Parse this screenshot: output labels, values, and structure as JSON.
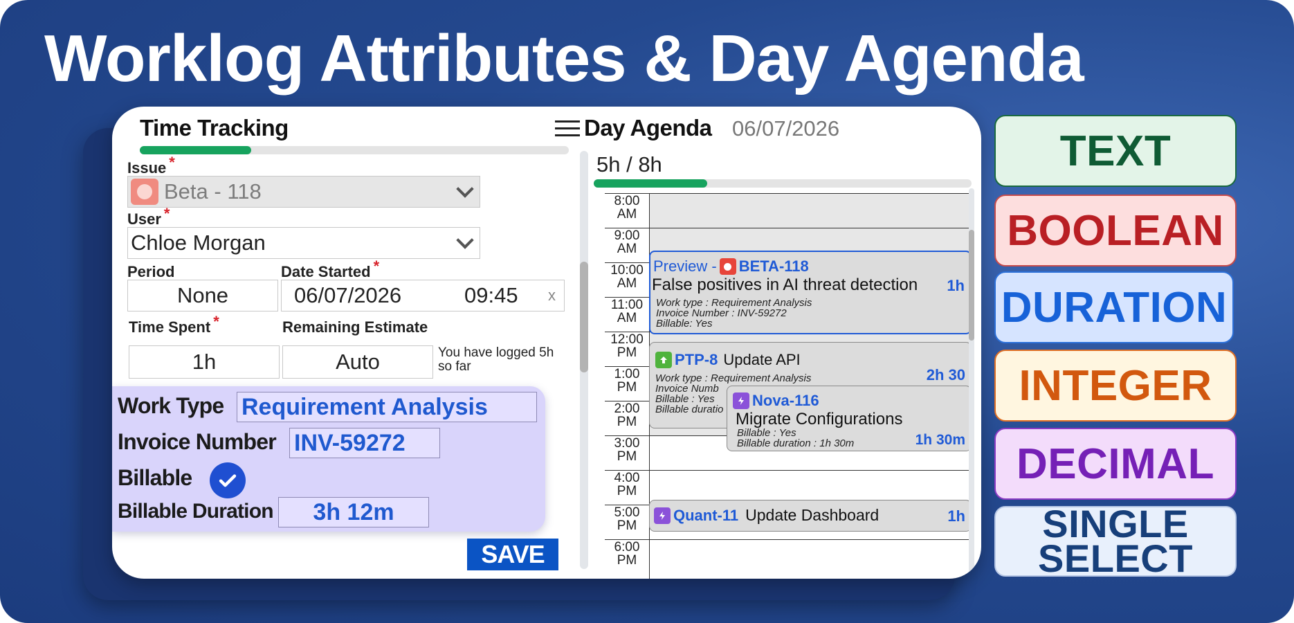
{
  "headline": "Worklog Attributes & Day Agenda",
  "form": {
    "title": "Time Tracking",
    "progress_fraction": 0.26,
    "issue_label": "Issue",
    "issue_value": "Beta - 118",
    "user_label": "User",
    "user_value": "Chloe Morgan",
    "period_label": "Period",
    "period_value": "None",
    "date_label": "Date Started",
    "date_value": "06/07/2026",
    "time_value": "09:45",
    "clear_symbol": "x",
    "time_spent_label": "Time Spent",
    "time_spent_value": "1h",
    "remaining_label": "Remaining Estimate",
    "remaining_value": "Auto",
    "logged_note": "You have logged 5h so far",
    "required_mark": "*",
    "attributes": {
      "work_type_label": "Work Type",
      "work_type_value": "Requirement Analysis",
      "invoice_label": "Invoice Number",
      "invoice_value": "INV-59272",
      "billable_label": "Billable",
      "billable_checked": true,
      "billable_duration_label": "Billable Duration",
      "billable_duration_value": "3h 12m"
    },
    "save_label": "SAVE"
  },
  "agenda": {
    "title": "Day Agenda",
    "date": "06/07/2026",
    "hours_summary": "5h / 8h",
    "progress_fraction": 0.3,
    "slots": [
      {
        "time": "8:00",
        "ampm": "AM"
      },
      {
        "time": "9:00",
        "ampm": "AM"
      },
      {
        "time": "10:00",
        "ampm": "AM"
      },
      {
        "time": "11:00",
        "ampm": "AM"
      },
      {
        "time": "12:00",
        "ampm": "PM"
      },
      {
        "time": "1:00",
        "ampm": "PM"
      },
      {
        "time": "2:00",
        "ampm": "PM"
      },
      {
        "time": "3:00",
        "ampm": "PM"
      },
      {
        "time": "4:00",
        "ampm": "PM"
      },
      {
        "time": "5:00",
        "ampm": "PM"
      },
      {
        "time": "6:00",
        "ampm": "PM"
      }
    ],
    "events": {
      "preview": {
        "prefix": "Preview -",
        "key": "BETA-118",
        "summary": "False positives in AI threat detection",
        "duration": "1h",
        "meta1": "Work type : Requirement Analysis",
        "meta2": "Invoice Number : INV-59272",
        "meta3": "Billable: Yes",
        "icon": "bug-icon"
      },
      "ptp": {
        "key": "PTP-8",
        "summary": "Update API",
        "duration": "2h 30",
        "meta1": "Work type : Requirement Analysis",
        "meta2": "Invoice Numb",
        "meta3": "Billable : Yes",
        "meta4": "Billable duratio",
        "icon": "story-icon"
      },
      "nova": {
        "key": "Nova-116",
        "summary": "Migrate Configurations",
        "duration": "1h 30m",
        "meta1": "Billable : Yes",
        "meta2": "Billable duration : 1h 30m",
        "icon": "epic-icon"
      },
      "quant": {
        "key": "Quant-11",
        "summary": "Update Dashboard",
        "duration": "1h",
        "icon": "epic-icon"
      }
    }
  },
  "chips": {
    "text": "TEXT",
    "boolean": "BOOLEAN",
    "duration": "DURATION",
    "integer": "INTEGER",
    "decimal": "DECIMAL",
    "single_select_line1": "SINGLE",
    "single_select_line2": "SELECT"
  },
  "colors": {
    "accent_blue": "#1f5ad6",
    "progress_green": "#17a35e",
    "save_blue": "#0b54c4",
    "attr_panel_bg": "#d9d4fb"
  }
}
